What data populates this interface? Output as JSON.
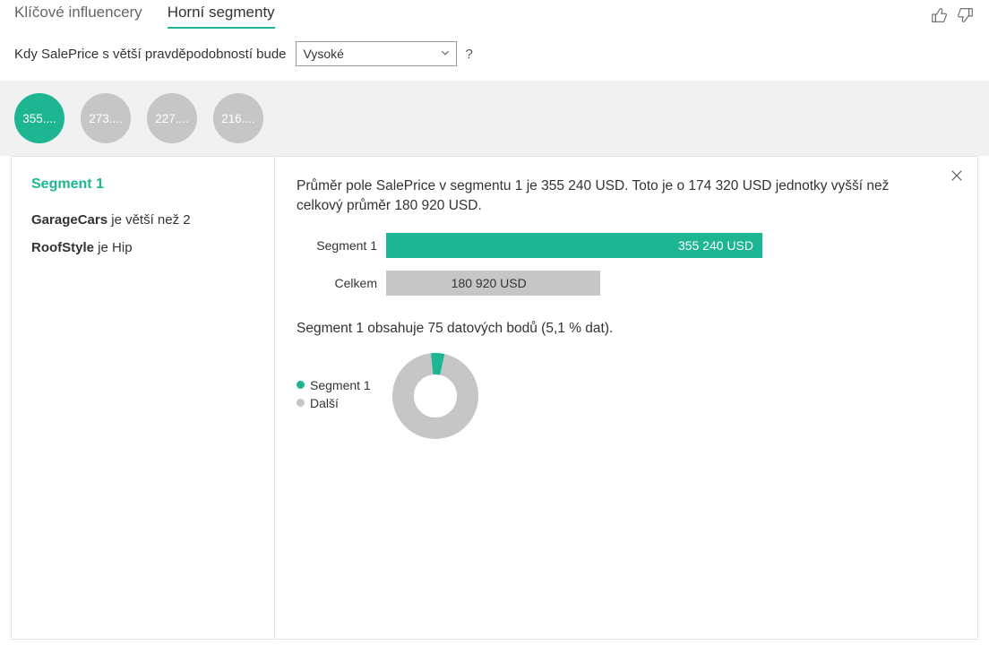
{
  "tabs": {
    "key_influencers": "Klíčové influencery",
    "top_segments": "Horní segmenty"
  },
  "query": {
    "prefix": "Kdy SalePrice s větší pravděpodobností bude",
    "selected": "Vysoké",
    "help": "?"
  },
  "bubbles": [
    "355....",
    "273....",
    "227....",
    "216...."
  ],
  "left_panel": {
    "title": "Segment 1",
    "cond1_field": "GarageCars",
    "cond1_rest": " je větší než 2",
    "cond2_field": "RoofStyle",
    "cond2_rest": " je Hip"
  },
  "right_panel": {
    "summary": "Průměr pole SalePrice v segmentu 1 je 355 240 USD. Toto je o 174 320 USD jednotky vyšší než celkový průměr 180 920 USD.",
    "bar_seg_label": "Segment 1",
    "bar_seg_value": "355 240 USD",
    "bar_total_label": "Celkem",
    "bar_total_value": "180 920 USD",
    "points_text": "Segment 1 obsahuje 75 datových bodů (5,1 % dat).",
    "legend_seg": "Segment 1",
    "legend_other": "Další"
  },
  "colors": {
    "accent": "#1db592",
    "grey": "#c6c6c6"
  },
  "chart_data": [
    {
      "type": "bar",
      "title": "",
      "categories": [
        "Segment 1",
        "Celkem"
      ],
      "values_usd": [
        355240,
        180920
      ],
      "xlabel": "",
      "ylabel": "",
      "xlim": [
        0,
        355240
      ]
    },
    {
      "type": "pie",
      "title": "",
      "series": [
        {
          "name": "Segment 1",
          "value": 5.1
        },
        {
          "name": "Další",
          "value": 94.9
        }
      ],
      "unit": "percent"
    }
  ]
}
